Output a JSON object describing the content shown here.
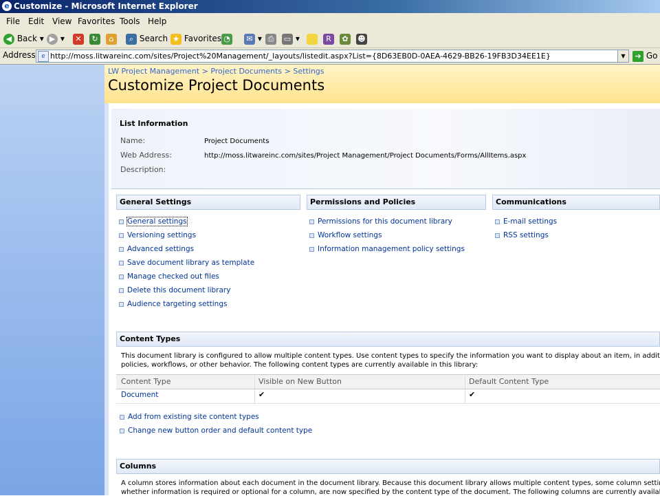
{
  "window": {
    "title": "Customize - Microsoft Internet Explorer"
  },
  "menu": [
    "File",
    "Edit",
    "View",
    "Favorites",
    "Tools",
    "Help"
  ],
  "toolbar": {
    "back": "Back",
    "search": "Search",
    "favorites": "Favorites"
  },
  "address": {
    "label": "Address",
    "url": "http://moss.litwareinc.com/sites/Project%20Management/_layouts/listedit.aspx?List={8D63EB0D-0AEA-4629-BB26-19FB3D34EE1E}",
    "go": "Go"
  },
  "breadcrumb": {
    "site": "LW Project Management",
    "sep1": ">",
    "library": "Project Documents",
    "sep2": ">",
    "current": "Settings"
  },
  "page_title": "Customize Project Documents",
  "list_info": {
    "heading": "List Information",
    "name_label": "Name:",
    "name_value": "Project Documents",
    "web_label": "Web Address:",
    "web_value": "http://moss.litwareinc.com/sites/Project Management/Project Documents/Forms/AllItems.aspx",
    "desc_label": "Description:"
  },
  "general_settings": {
    "heading": "General Settings",
    "links": [
      "General settings",
      "Versioning settings",
      "Advanced settings",
      "Save document library as template",
      "Manage checked out files",
      "Delete this document library",
      "Audience targeting settings"
    ]
  },
  "permissions": {
    "heading": "Permissions and Policies",
    "links": [
      "Permissions for this document library",
      "Workflow settings",
      "Information management policy settings"
    ]
  },
  "communications": {
    "heading": "Communications",
    "links": [
      "E-mail settings",
      "RSS settings"
    ]
  },
  "content_types": {
    "heading": "Content Types",
    "desc_line1": "This document library is configured to allow multiple content types. Use content types to specify the information you want to display about an item, in addition to its",
    "desc_line2": "policies, workflows, or other behavior. The following content types are currently available in this library:",
    "columns": [
      "Content Type",
      "Visible on New Button",
      "Default Content Type"
    ],
    "rows": [
      {
        "name": "Document",
        "visible": "✔",
        "default": "✔"
      }
    ],
    "links": [
      "Add from existing site content types",
      "Change new button order and default content type"
    ]
  },
  "columns_section": {
    "heading": "Columns",
    "desc_line1": "A column stores information about each document in the document library. Because this document library allows multiple content types, some column settings, such",
    "desc_line2": "whether information is required or optional for a column, are now specified by the content type of the document. The following columns are currently available in th"
  }
}
